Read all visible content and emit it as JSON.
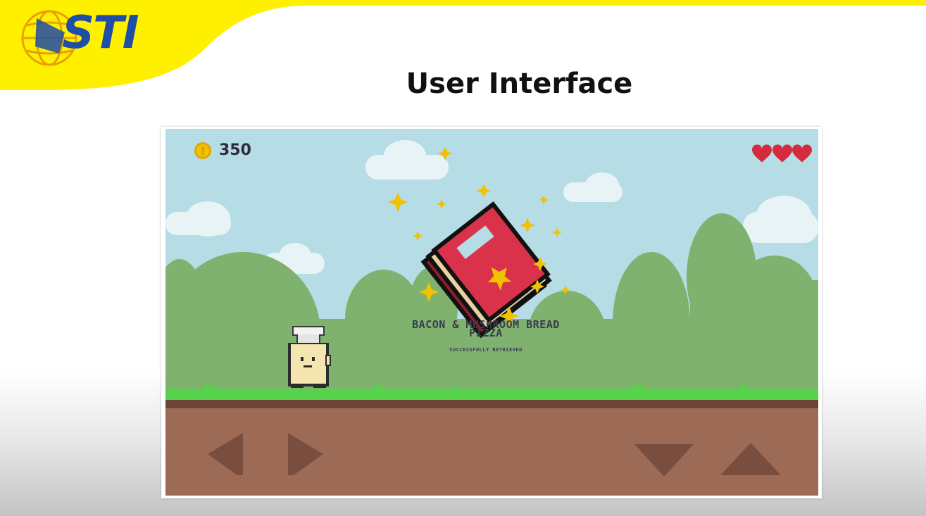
{
  "slide": {
    "logo_text": "STI",
    "title": "User Interface"
  },
  "game": {
    "coins": "350",
    "lives": 3,
    "reward": {
      "title": "BACON & MUSHROOM BREAD PIZZA",
      "subtitle": "SUCCESSFULLY RETRIEVED"
    },
    "controls": [
      "left",
      "right",
      "down",
      "up"
    ],
    "colors": {
      "sky": "#b6dce6",
      "hills": "#7eb26e",
      "grass": "#56d34b",
      "dirt": "#9d6a56",
      "coin": "#f2c200",
      "heart": "#d62b3c",
      "book": "#d9324a",
      "banner": "#fff000"
    }
  }
}
